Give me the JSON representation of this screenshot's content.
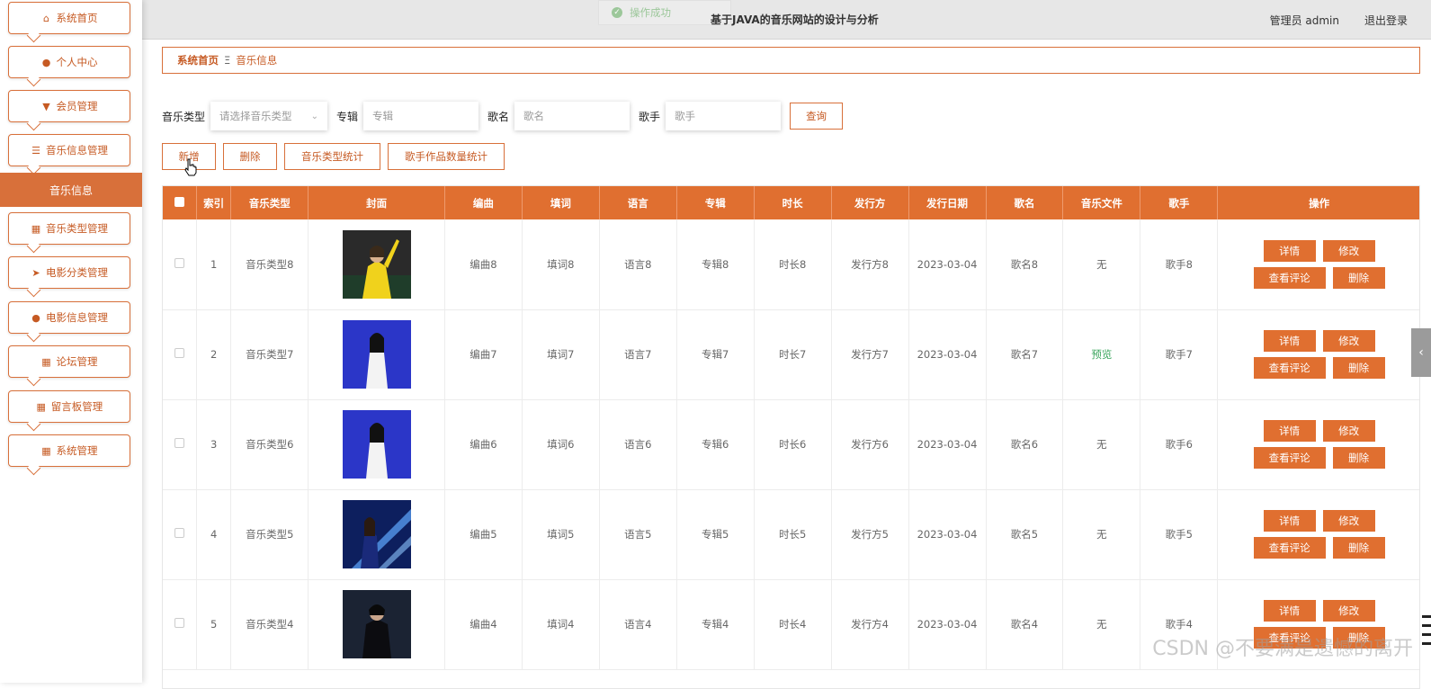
{
  "sidebar": {
    "items": [
      {
        "label": "系统首页",
        "icon": "home-icon"
      },
      {
        "label": "个人中心",
        "icon": "user-icon"
      },
      {
        "label": "会员管理",
        "icon": "member-icon"
      },
      {
        "label": "音乐信息管理",
        "icon": "list-icon"
      },
      {
        "label": "音乐类型管理",
        "icon": "grid-icon"
      },
      {
        "label": "电影分类管理",
        "icon": "send-icon"
      },
      {
        "label": "电影信息管理",
        "icon": "bulb-icon"
      },
      {
        "label": "论坛管理",
        "icon": "grid-icon"
      },
      {
        "label": "留言板管理",
        "icon": "grid-nine-icon"
      },
      {
        "label": "系统管理",
        "icon": "grid-icon"
      }
    ],
    "active_submenu": "音乐信息"
  },
  "header": {
    "toast": "操作成功",
    "title": "基于JAVA的音乐网站的设计与分析",
    "admin": "管理员 admin",
    "logout": "退出登录"
  },
  "breadcrumb": {
    "home": "系统首页",
    "separator": "Ξ",
    "current": "音乐信息"
  },
  "search": {
    "type_label": "音乐类型",
    "type_placeholder": "请选择音乐类型",
    "album_label": "专辑",
    "album_placeholder": "专辑",
    "song_label": "歌名",
    "song_placeholder": "歌名",
    "singer_label": "歌手",
    "singer_placeholder": "歌手",
    "query": "查询"
  },
  "actions": {
    "add": "新增",
    "delete": "删除",
    "type_stats": "音乐类型统计",
    "singer_stats": "歌手作品数量统计"
  },
  "table": {
    "headers": [
      "索引",
      "音乐类型",
      "封面",
      "编曲",
      "填词",
      "语言",
      "专辑",
      "时长",
      "发行方",
      "发行日期",
      "歌名",
      "音乐文件",
      "歌手",
      "操作"
    ],
    "op_labels": {
      "detail": "详情",
      "edit": "修改",
      "comments": "查看评论",
      "delete": "删除"
    },
    "rows": [
      {
        "index": "1",
        "type": "音乐类型8",
        "arrange": "编曲8",
        "lyric": "填词8",
        "lang": "语言8",
        "album": "专辑8",
        "duration": "时长8",
        "publisher": "发行方8",
        "date": "2023-03-04",
        "song": "歌名8",
        "file": "无",
        "singer": "歌手8",
        "cover": "yellow"
      },
      {
        "index": "2",
        "type": "音乐类型7",
        "arrange": "编曲7",
        "lyric": "填词7",
        "lang": "语言7",
        "album": "专辑7",
        "duration": "时长7",
        "publisher": "发行方7",
        "date": "2023-03-04",
        "song": "歌名7",
        "file": "预览",
        "singer": "歌手7",
        "cover": "blue"
      },
      {
        "index": "3",
        "type": "音乐类型6",
        "arrange": "编曲6",
        "lyric": "填词6",
        "lang": "语言6",
        "album": "专辑6",
        "duration": "时长6",
        "publisher": "发行方6",
        "date": "2023-03-04",
        "song": "歌名6",
        "file": "无",
        "singer": "歌手6",
        "cover": "blue"
      },
      {
        "index": "4",
        "type": "音乐类型5",
        "arrange": "编曲5",
        "lyric": "填词5",
        "lang": "语言5",
        "album": "专辑5",
        "duration": "时长5",
        "publisher": "发行方5",
        "date": "2023-03-04",
        "song": "歌名5",
        "file": "无",
        "singer": "歌手5",
        "cover": "stage"
      },
      {
        "index": "5",
        "type": "音乐类型4",
        "arrange": "编曲4",
        "lyric": "填词4",
        "lang": "语言4",
        "album": "专辑4",
        "duration": "时长4",
        "publisher": "发行方4",
        "date": "2023-03-04",
        "song": "歌名4",
        "file": "无",
        "singer": "歌手4",
        "cover": "dark"
      }
    ]
  },
  "watermark": "CSDN @不要满是遗憾的离开",
  "colors": {
    "accent": "#e06f30",
    "accent_text": "#c65a23",
    "preview": "#3aa55c"
  }
}
